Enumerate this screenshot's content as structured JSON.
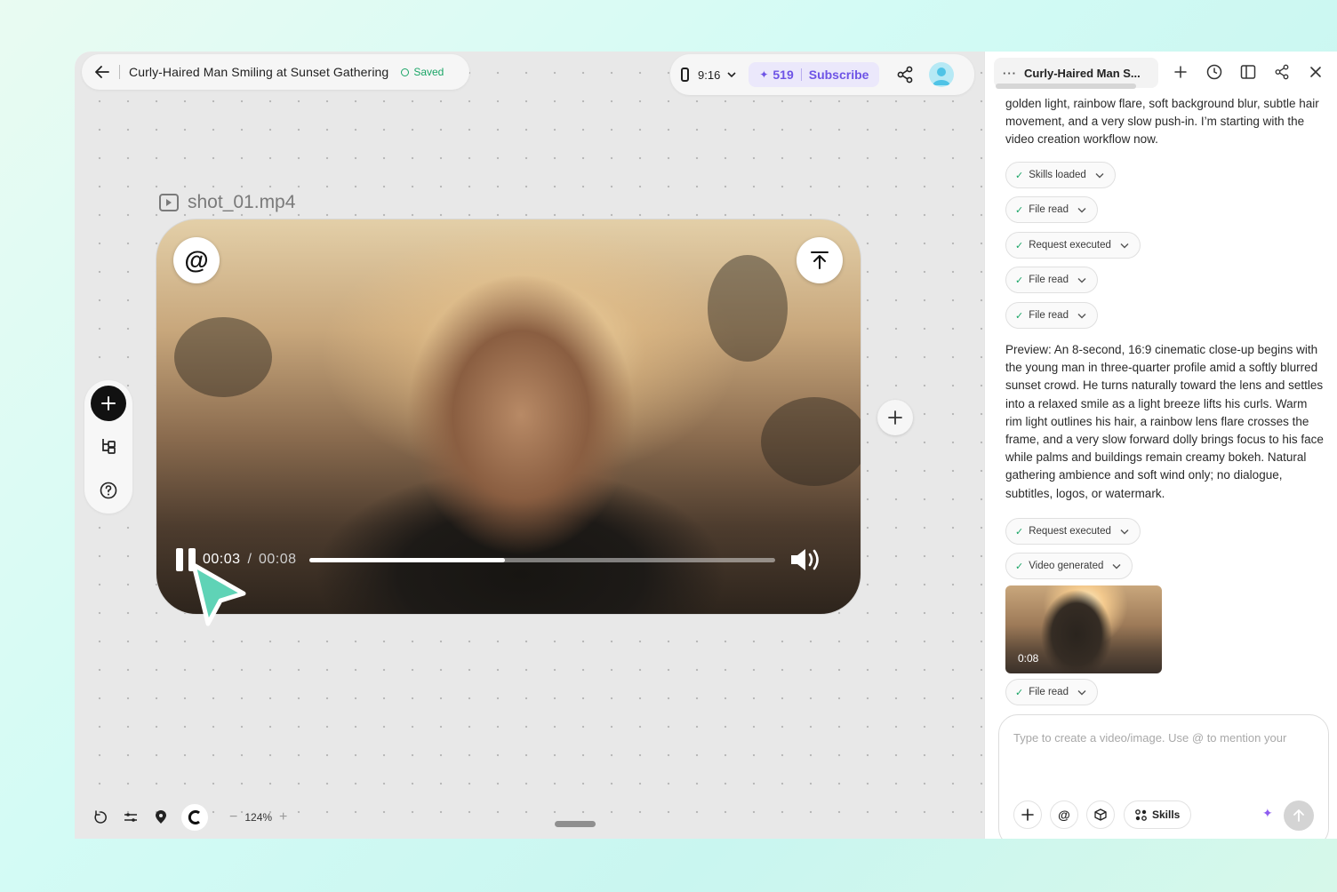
{
  "header": {
    "doc_title": "Curly-Haired Man Smiling at Sunset Gathering",
    "saved_label": "Saved",
    "ratio_label": "9:16",
    "credits": "519",
    "subscribe_label": "Subscribe"
  },
  "canvas": {
    "file_name": "shot_01.mp4",
    "zoom_level": "124%"
  },
  "player": {
    "current_time": "00:03",
    "separator": "/",
    "total_time": "00:08",
    "progress": 0.42
  },
  "chat": {
    "tab_title": "Curly-Haired Man S...",
    "intro_text": "golden light, rainbow flare, soft background blur, subtle hair movement, and a very slow push-in. I’m starting with the video creation workflow now.",
    "chips_top": [
      "Skills loaded",
      "File read",
      "Request executed",
      "File read",
      "File read"
    ],
    "preview_text": "Preview: An 8-second, 16:9 cinematic close-up begins with the young man in three-quarter profile amid a softly blurred sunset crowd. He turns naturally toward the lens and settles into a relaxed smile as a light breeze lifts his curls. Warm rim light outlines his hair, a rainbow lens flare crosses the frame, and a very slow forward dolly brings focus to his face while palms and buildings remain creamy bokeh. Natural gathering ambience and soft wind only; no dialogue, subtitles, logos, or watermark.",
    "chips_mid": [
      "Request executed",
      "Video generated"
    ],
    "thumb_duration": "0:08",
    "chip_bottom": "File read",
    "composer_placeholder": "Type to create a video/image. Use @ to mention your",
    "skills_label": "Skills"
  },
  "colors": {
    "accent_purple": "#6e54e6",
    "saved_green": "#1aa566",
    "cursor_teal": "#5fd3b6"
  }
}
